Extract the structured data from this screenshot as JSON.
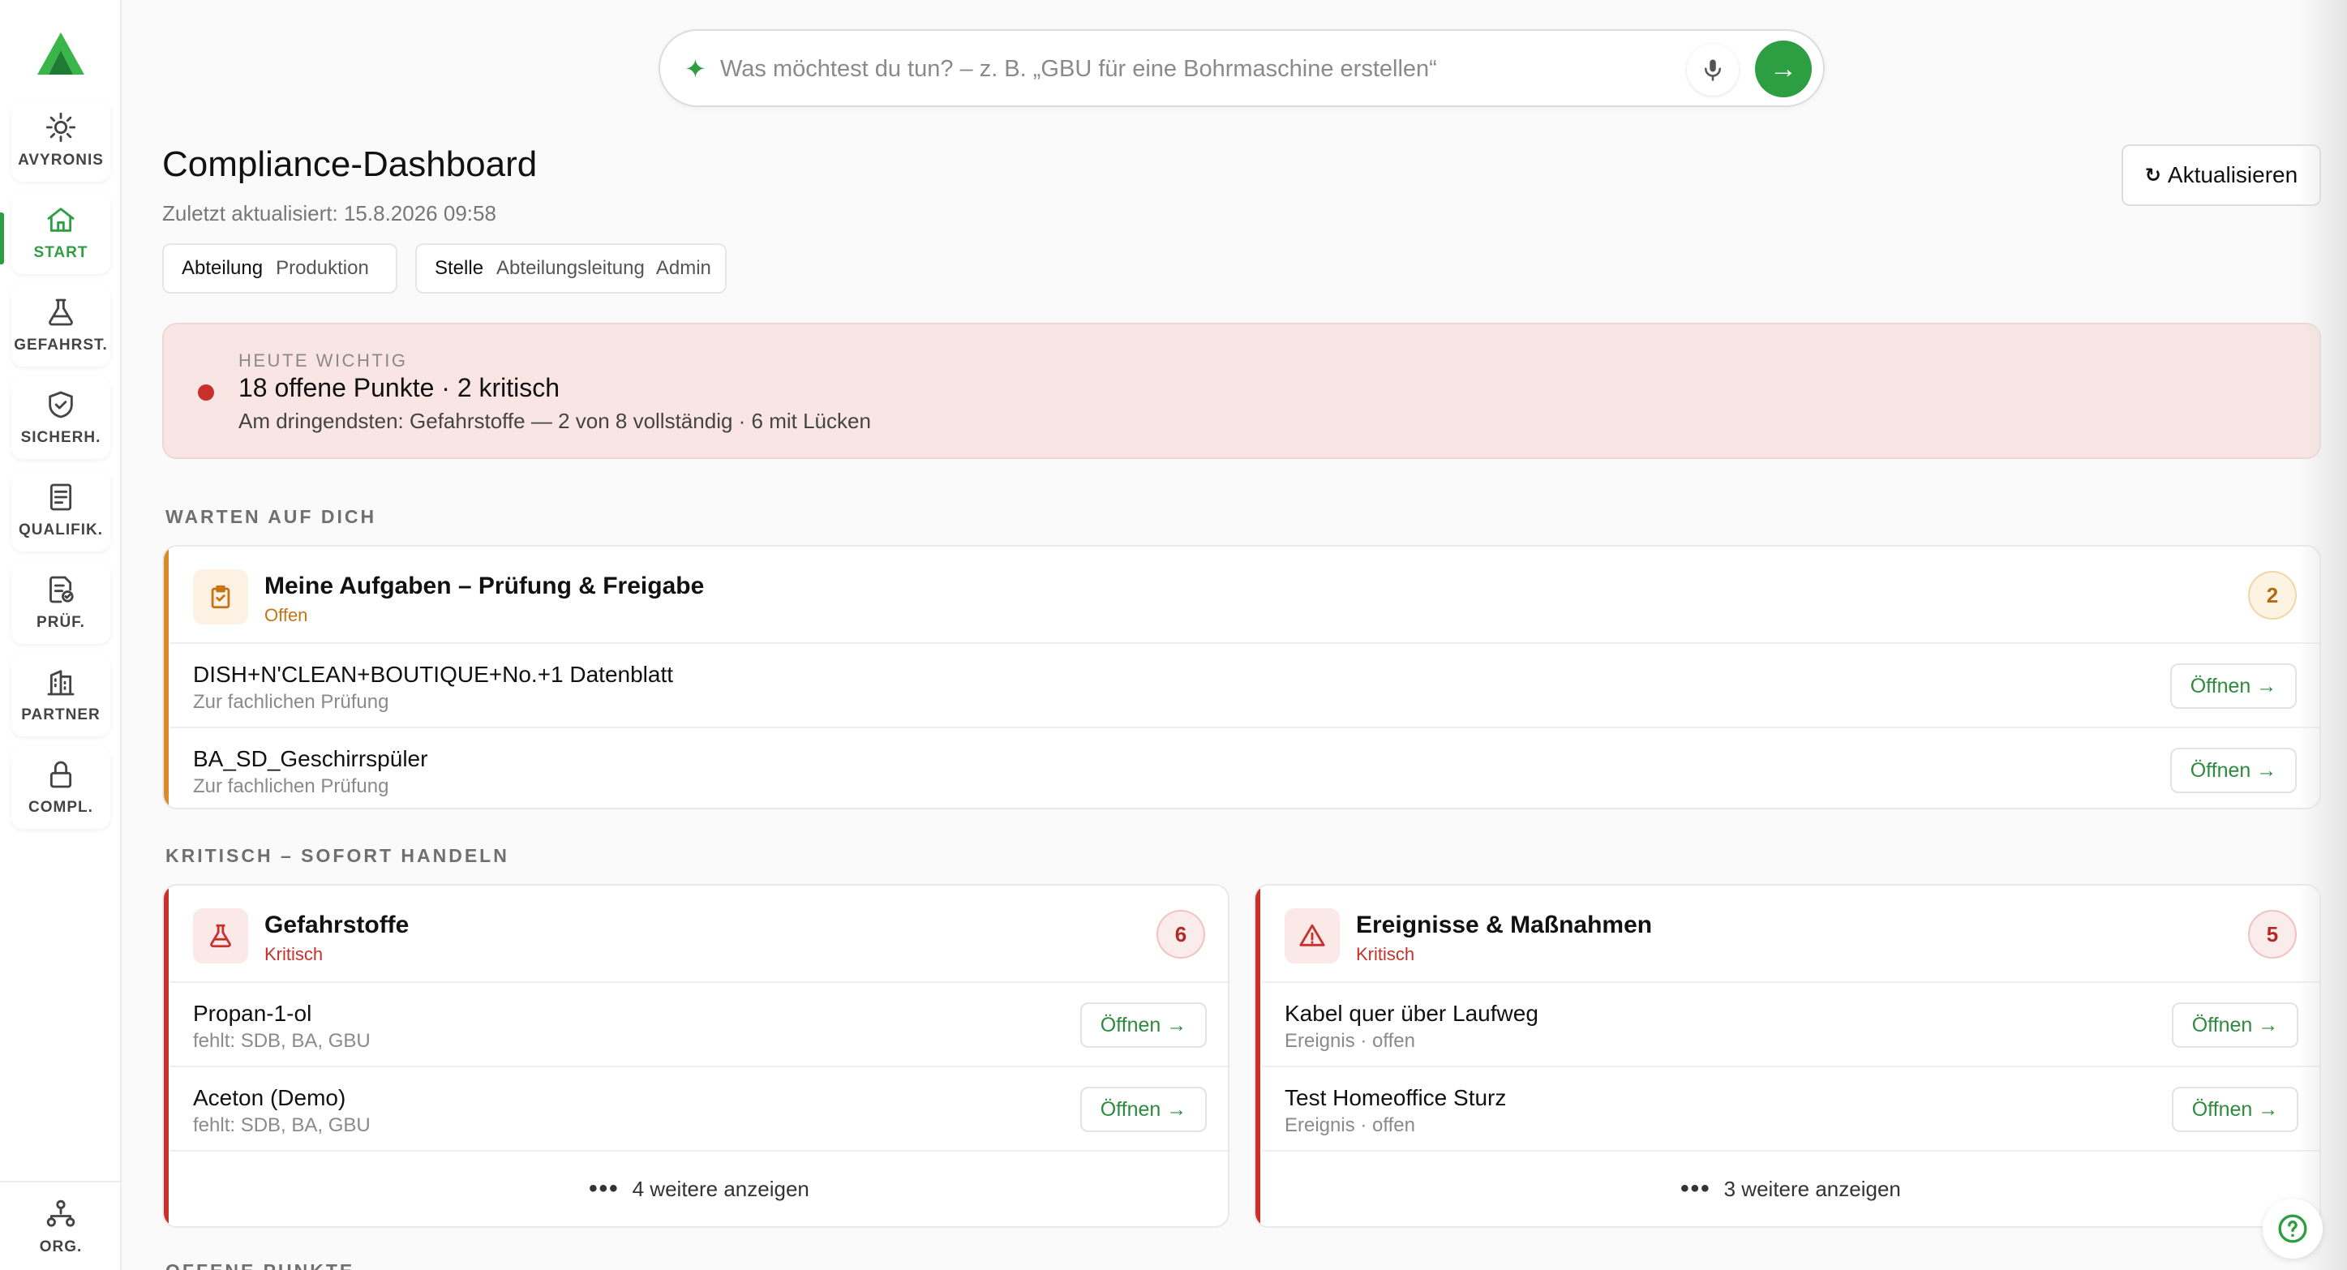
{
  "sidebar": {
    "items": [
      {
        "label": "AVYRONIS",
        "icon": "sun-icon"
      },
      {
        "label": "START",
        "icon": "home-icon"
      },
      {
        "label": "GEFAHRST.",
        "icon": "flask-icon"
      },
      {
        "label": "SICHERH.",
        "icon": "shield-check-icon"
      },
      {
        "label": "QUALIFIK.",
        "icon": "document-icon"
      },
      {
        "label": "PRÜF.",
        "icon": "document-check-icon"
      },
      {
        "label": "PARTNER",
        "icon": "building-icon"
      },
      {
        "label": "COMPL.",
        "icon": "lock-icon"
      }
    ],
    "bottom_item": {
      "label": "ORG.",
      "icon": "org-chart-icon"
    }
  },
  "search": {
    "placeholder": "Was möchtest du tun? – z. B. „GBU für eine Bohrmaschine erstellen“",
    "value": ""
  },
  "header": {
    "title": "Compliance-Dashboard",
    "updated": "Zuletzt aktualisiert: 15.8.2026 09:58",
    "chips": {
      "department_key": "Abteilung",
      "department_value": "Produktion",
      "position_key": "Stelle",
      "position_value": "Abteilungsleitung",
      "role_value": "Admin"
    },
    "refresh_label": "Aktualisieren"
  },
  "alert": {
    "eyebrow": "HEUTE WICHTIG",
    "headline": "18 offene Punkte · 2 kritisch",
    "sub": "Am dringendsten: Gefahrstoffe — 2 von 8 vollständig · 6 mit Lücken"
  },
  "sections": {
    "waiting": "WARTEN AUF DICH",
    "critical": "KRITISCH – SOFORT HANDELN",
    "open_points": "OFFENE PUNKTE"
  },
  "cards": {
    "tasks": {
      "title": "Meine Aufgaben – Prüfung & Freigabe",
      "status": "Offen",
      "count": "2",
      "rows": [
        {
          "title": "DISH+N'CLEAN+BOUTIQUE+No.+1 Datenblatt",
          "sub": "Zur fachlichen Prüfung",
          "action": "Öffnen →"
        },
        {
          "title": "BA_SD_Geschirrspüler",
          "sub": "Zur fachlichen Prüfung",
          "action": "Öffnen →"
        }
      ]
    },
    "hazardous": {
      "title": "Gefahrstoffe",
      "status": "Kritisch",
      "count": "6",
      "rows": [
        {
          "title": "Propan-1-ol",
          "sub": "fehlt: SDB, BA, GBU",
          "action": "Öffnen →"
        },
        {
          "title": "Aceton (Demo)",
          "sub": "fehlt: SDB, BA, GBU",
          "action": "Öffnen →"
        }
      ],
      "more": "4 weitere anzeigen"
    },
    "incidents": {
      "title": "Ereignisse & Maßnahmen",
      "status": "Kritisch",
      "count": "5",
      "rows": [
        {
          "title": "Kabel quer über Laufweg",
          "sub": "Ereignis · offen",
          "action": "Öffnen →"
        },
        {
          "title": "Test Homeoffice Sturz",
          "sub": "Ereignis · offen",
          "action": "Öffnen →"
        }
      ],
      "more": "3 weitere anzeigen"
    }
  },
  "colors": {
    "brand": "#2e9e43",
    "critical": "#c8302b",
    "warning": "#d98a2b",
    "alert_bg": "#f9e6e4"
  }
}
